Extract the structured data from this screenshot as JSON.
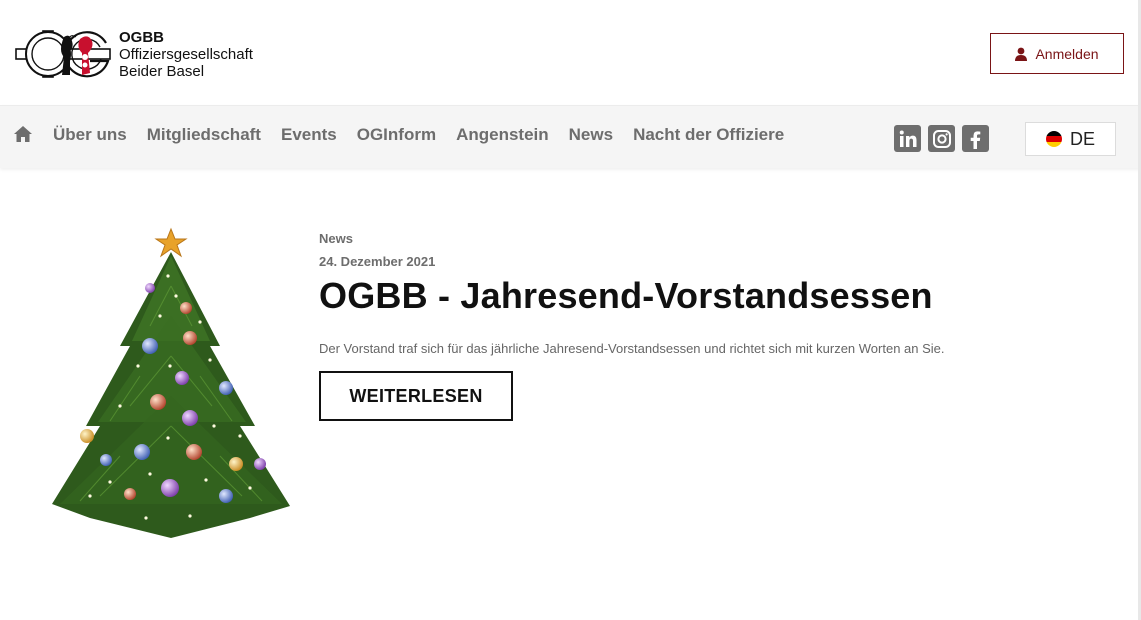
{
  "header": {
    "logo": {
      "abbr": "OGBB",
      "line1": "Offiziersgesellschaft",
      "line2": "Beider Basel"
    },
    "login_label": "Anmelden",
    "accent_color": "#7a1416"
  },
  "nav": {
    "home_icon": "home-icon",
    "items": [
      "Über uns",
      "Mitgliedschaft",
      "Events",
      "OGInform",
      "Angenstein",
      "News",
      "Nacht der Offiziere"
    ],
    "social": [
      "linkedin-icon",
      "instagram-icon",
      "facebook-icon"
    ],
    "language": "DE"
  },
  "article": {
    "category": "News",
    "date": "24. Dezember 2021",
    "title": "OGBB - Jahresend-Vorstandsessen",
    "excerpt": "Der Vorstand traf sich für das jährliche Jahresend-Vorstandsessen und richtet sich mit kurzen Worten an Sie.",
    "button_label": "WEITERLESEN"
  }
}
